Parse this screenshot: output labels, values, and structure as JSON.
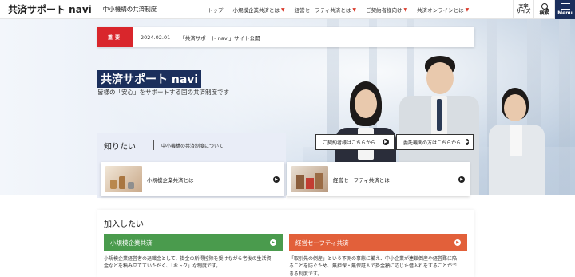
{
  "header": {
    "logo": "共済サポート navi",
    "subtitle": "中小機構の共済制度",
    "nav": [
      {
        "label": "トップ",
        "dropdown": false
      },
      {
        "label": "小規模企業共済とは",
        "dropdown": true
      },
      {
        "label": "経営セーフティ共済とは",
        "dropdown": true
      },
      {
        "label": "ご契約者様向け",
        "dropdown": true
      },
      {
        "label": "共済オンラインとは",
        "dropdown": true
      }
    ],
    "font_size_line1": "文字",
    "font_size_line2": "サイズ",
    "search_label": "検索",
    "menu_label": "Menu"
  },
  "notice": {
    "badge": "重要",
    "date": "2024.02.01",
    "text": "「共済サポート navi」サイト公開"
  },
  "hero": {
    "title": "共済サポート navi",
    "subtitle": "皆様の「安心」をサポートする国の共済制度です"
  },
  "cta": {
    "contractors": "ご契約者様はこちらから",
    "agencies": "委託機関の方はこちらから"
  },
  "know": {
    "title": "知りたい",
    "desc": "中小機構の共済制度について",
    "cards": [
      {
        "label": "小規模企業共済とは"
      },
      {
        "label": "経営セーフティ共済とは"
      }
    ]
  },
  "join": {
    "title": "加入したい",
    "items": [
      {
        "label": "小規模企業共済",
        "color": "#4a9b4d",
        "desc_line1": "小規模企業経営者の退職金として、掛金の所得控除を受けながら老後の生活資",
        "desc_line2": "金などを積み立てていただく、「おトク」な制度です。"
      },
      {
        "label": "経営セーフティ共済",
        "color": "#e2603a",
        "desc_line1": "「取引先の倒産」という不測の事態に備え、中小企業が連鎖倒産や経営難に陥",
        "desc_line2": "ることを防ぐため、無担保・無保証人で掛金額に応じた借入れをすることがで",
        "desc_line3": "きる制度です。"
      }
    ]
  },
  "colors": {
    "brand_navy": "#1b2f5c",
    "notice_red": "#d9262c",
    "chevron_red": "#d93a2b",
    "panel_bg": "#e9edf7"
  }
}
